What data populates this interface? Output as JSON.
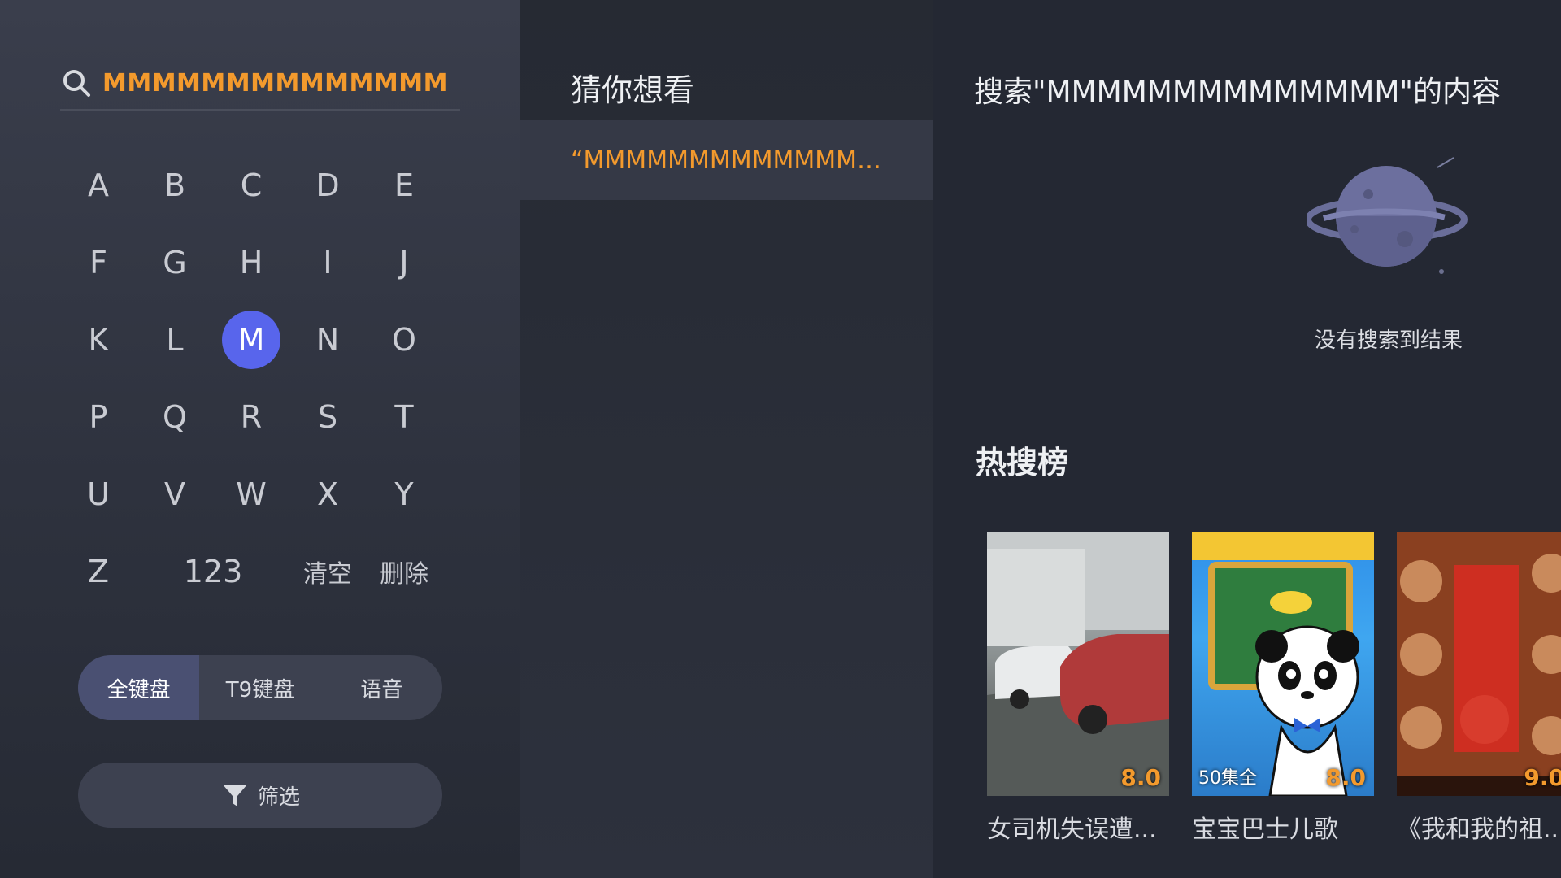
{
  "search": {
    "query": "MMMMMMMMMMMMMM"
  },
  "keyboard": {
    "rows": [
      [
        "A",
        "B",
        "C",
        "D",
        "E"
      ],
      [
        "F",
        "G",
        "H",
        "I",
        "J"
      ],
      [
        "K",
        "L",
        "M",
        "N",
        "O"
      ],
      [
        "P",
        "Q",
        "R",
        "S",
        "T"
      ],
      [
        "U",
        "V",
        "W",
        "X",
        "Y"
      ]
    ],
    "active_key": "M",
    "last_row": {
      "z": "Z",
      "num": "123",
      "clear": "清空",
      "delete": "删除"
    }
  },
  "modes": {
    "full": "全键盘",
    "t9": "T9键盘",
    "voice": "语音",
    "selected": "full"
  },
  "filter": {
    "label": "筛选"
  },
  "suggestions": {
    "title": "猜你想看",
    "items": [
      "“MMMMMMMMMMMMMM..."
    ]
  },
  "results": {
    "title": "搜索\"MMMMMMMMMMMMMM\"的内容",
    "empty_text": "没有搜索到结果",
    "hot_title": "热搜榜",
    "cards": [
      {
        "title": "女司机失误遭...",
        "rating": "8.0",
        "badge": ""
      },
      {
        "title": "宝宝巴士儿歌",
        "rating": "8.0",
        "badge": "50集全"
      },
      {
        "title": "《我和我的祖...",
        "rating": "9.0",
        "badge": ""
      }
    ]
  },
  "colors": {
    "accent": "#f39a2d",
    "key_highlight": "#5865ec"
  }
}
